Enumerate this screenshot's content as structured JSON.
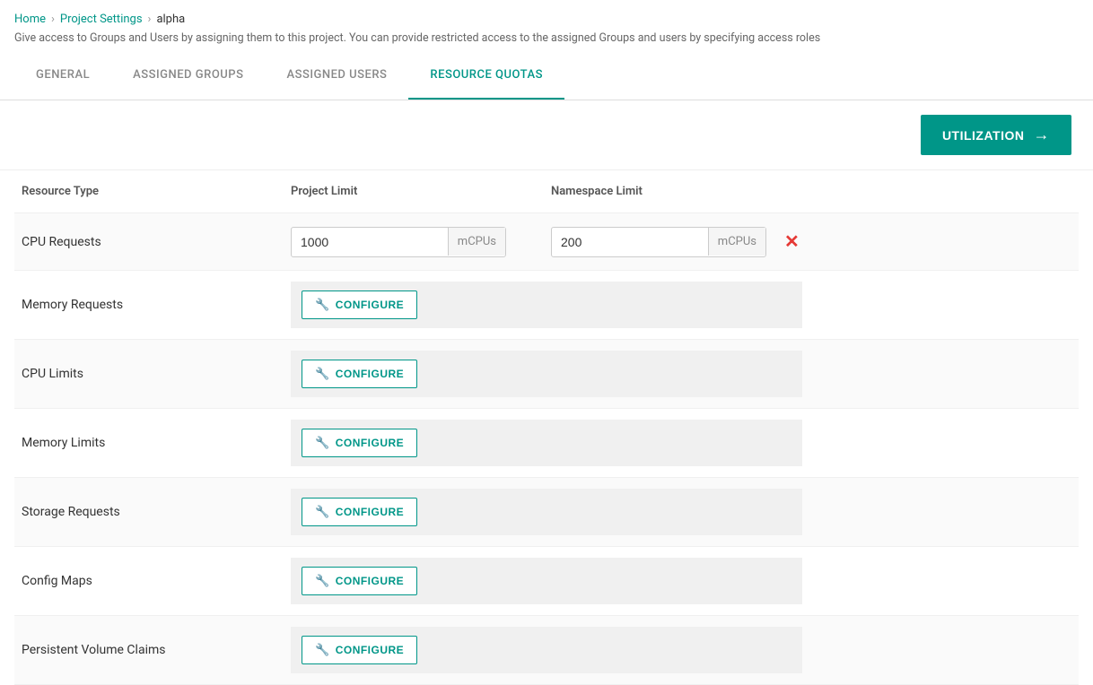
{
  "breadcrumb": {
    "home": "Home",
    "project_settings": "Project Settings",
    "project_name": "alpha"
  },
  "subtitle": "Give access to Groups and Users by assigning them to this project. You can provide restricted access to the assigned Groups and users by specifying access roles",
  "tabs": [
    {
      "id": "general",
      "label": "GENERAL",
      "active": false
    },
    {
      "id": "assigned-groups",
      "label": "ASSIGNED GROUPS",
      "active": false
    },
    {
      "id": "assigned-users",
      "label": "ASSIGNED USERS",
      "active": false
    },
    {
      "id": "resource-quotas",
      "label": "RESOURCE QUOTAS",
      "active": true
    }
  ],
  "utilization_button": "UTILIZATION",
  "table": {
    "headers": [
      "Resource Type",
      "Project Limit",
      "Namespace Limit"
    ],
    "rows": [
      {
        "resource": "CPU Requests",
        "type": "input",
        "project_value": "1000",
        "project_unit": "mCPUs",
        "namespace_value": "200",
        "namespace_unit": "mCPUs",
        "has_delete": true
      },
      {
        "resource": "Memory Requests",
        "type": "configure"
      },
      {
        "resource": "CPU Limits",
        "type": "configure"
      },
      {
        "resource": "Memory Limits",
        "type": "configure"
      },
      {
        "resource": "Storage Requests",
        "type": "configure"
      },
      {
        "resource": "Config Maps",
        "type": "configure"
      },
      {
        "resource": "Persistent Volume Claims",
        "type": "configure"
      }
    ]
  },
  "configure_label": "CONFIGURE",
  "delete_icon": "✕",
  "arrow_icon": "→"
}
